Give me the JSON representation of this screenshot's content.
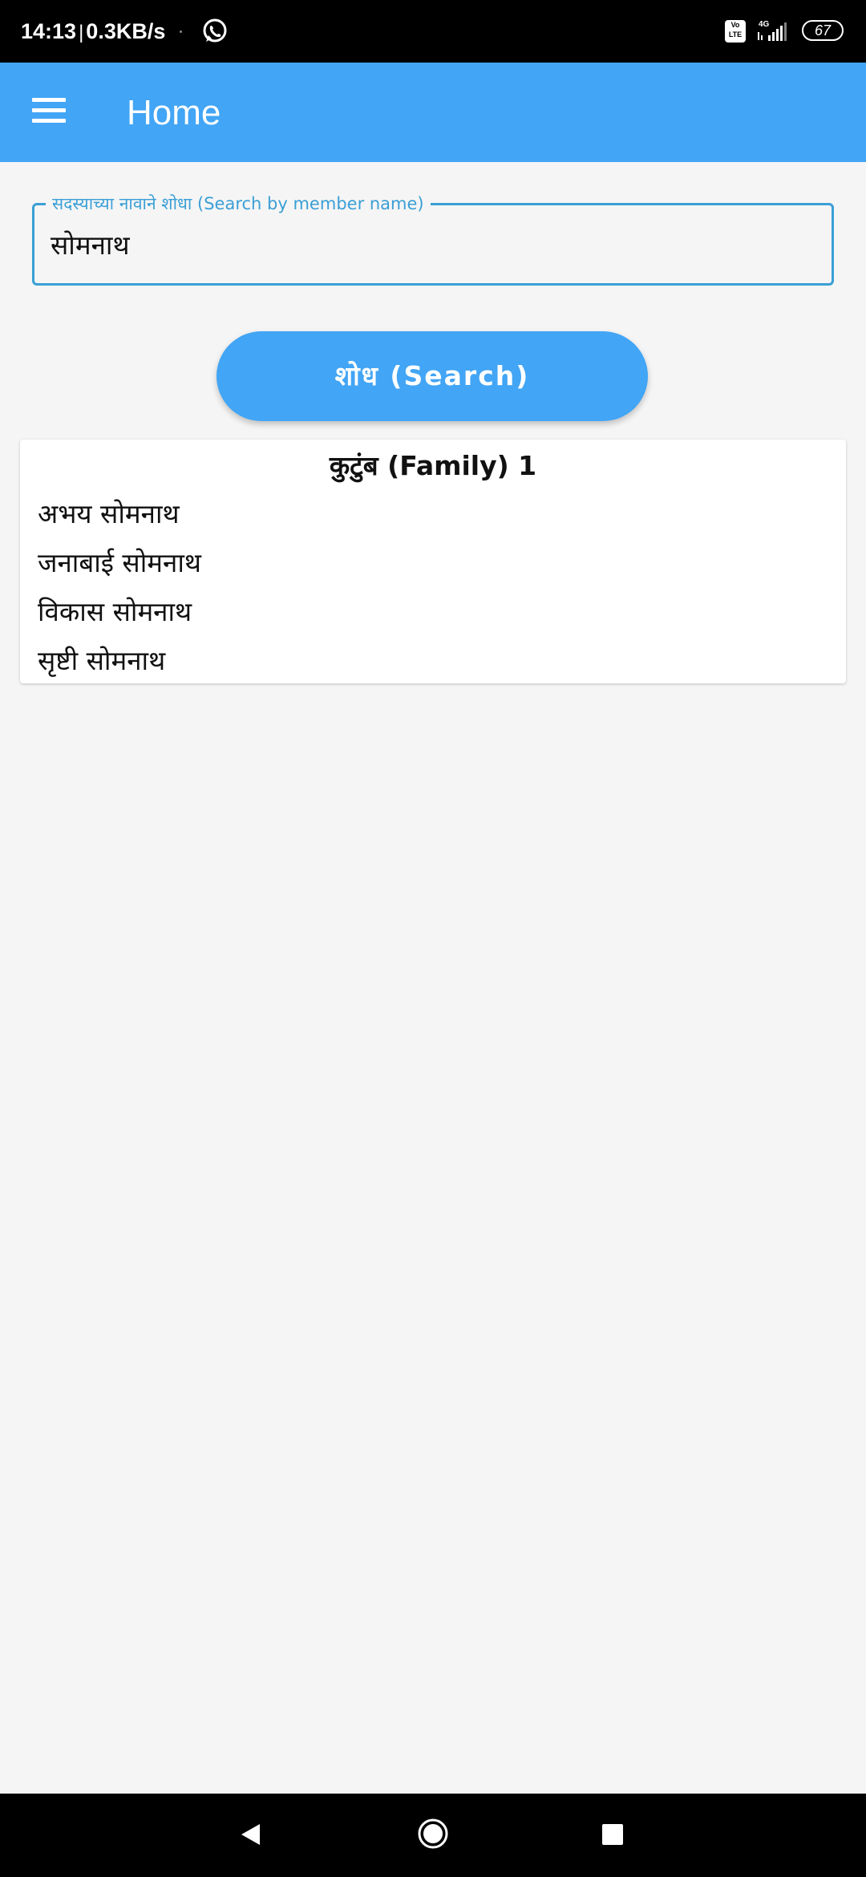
{
  "status_bar": {
    "time": "14:13",
    "separator": "|",
    "net_speed": "0.3KB/s",
    "volte_top": "Vo",
    "volte_bottom": "LTE",
    "network_type": "4G",
    "battery": "67",
    "notification_icon": "whatsapp-icon"
  },
  "app_bar": {
    "title": "Home",
    "menu_icon": "hamburger-menu-icon"
  },
  "search": {
    "label": "सदस्याच्या नावाने शोधा (Search by member name)",
    "value": "सोमनाथ",
    "button_label": "शोध (Search)"
  },
  "results": [
    {
      "title": "कुटुंब (Family) 1",
      "members": [
        "अभय सोमनाथ",
        "जनाबाई सोमनाथ",
        "विकास सोमनाथ",
        "सृष्टी सोमनाथ"
      ]
    }
  ],
  "colors": {
    "primary": "#42a5f5",
    "field_accent": "#3a9fd6",
    "background": "#f5f5f5",
    "system_bar": "#000000"
  },
  "nav_bar": {
    "back_icon": "back-triangle-icon",
    "home_icon": "home-circle-icon",
    "recents_icon": "recents-square-icon"
  }
}
